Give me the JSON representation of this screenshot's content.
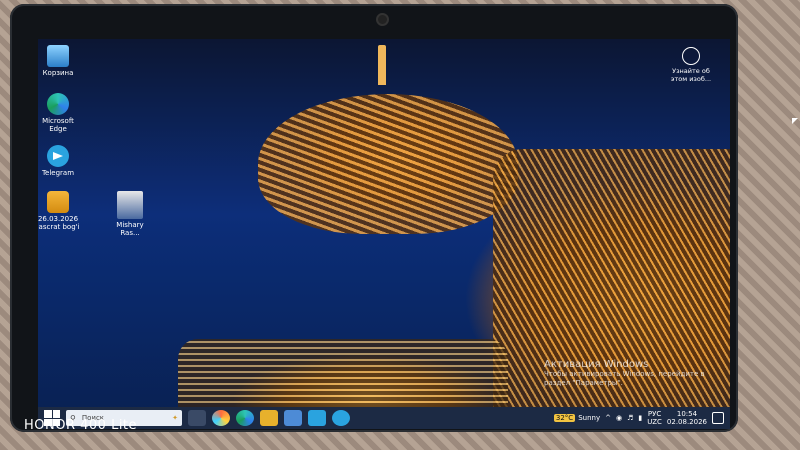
{
  "desktop_icons": [
    {
      "icon": "recycle-bin-icon",
      "label": "Корзина"
    },
    {
      "icon": "edge-icon",
      "label": "Microsoft Edge"
    },
    {
      "icon": "telegram-icon",
      "label": "Telegram"
    },
    {
      "icon": "folder-icon",
      "label": "26.03.2026 Jascrat bog'i"
    },
    {
      "icon": "photo-icon",
      "label": "Mishary Ras..."
    }
  ],
  "spotlight": {
    "label": "Узнайте об этом изоб..."
  },
  "activation": {
    "title": "Активация Windows",
    "body": "Чтобы активировать Windows, перейдите в раздел \"Параметры\"."
  },
  "taskbar": {
    "search_placeholder": "Поиск",
    "weather_temp": "32°C",
    "weather_label": "Sunny",
    "lang_top": "РУС",
    "lang_bottom": "UZC",
    "time": "10:54",
    "date": "02.08.2026"
  },
  "device_brand": "HONOR 400 Lite",
  "colors": {
    "taskbar": "#1c2a44",
    "activation_text": "#c0c7d4",
    "temp_badge": "#f1c341"
  }
}
